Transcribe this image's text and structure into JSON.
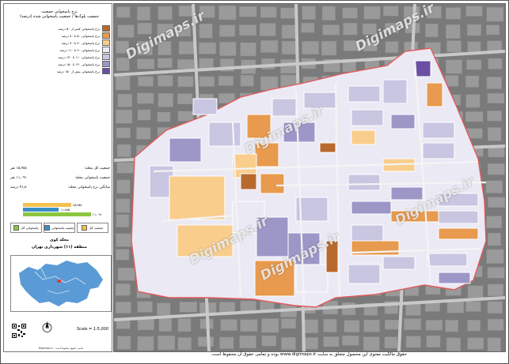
{
  "legend": {
    "title": "نرخ پاسخوانی جمعیت",
    "subtitle": "جمعیت بلوک‌ها / جمعیت پاسخوانی شده (درصد)",
    "items": [
      {
        "label": "نرخ پاسخوانی کمتر از ۵۰ درصد",
        "color": "#b8692e"
      },
      {
        "label": "نرخ پاسخوانی ۵۰ تا ۷۰ درصد",
        "color": "#e89a4e"
      },
      {
        "label": "نرخ پاسخوانی ۷۰ تا ۹۰ درصد",
        "color": "#f9cd8c"
      },
      {
        "label": "نرخ پاسخوانی ۹۰ تا ۱۱۰ درصد",
        "color": "#ebe9f4"
      },
      {
        "label": "نرخ پاسخوانی ۱۱۰ تا ۱۳۰ درصد",
        "color": "#c9c6e2"
      },
      {
        "label": "نرخ پاسخوانی ۱۳۰ تا ۱۵۰ درصد",
        "color": "#9d97c8"
      },
      {
        "label": "نرخ پاسخوانی بیش از ۱۵۰ درصد",
        "color": "#6a4fa2"
      }
    ]
  },
  "stats": [
    {
      "label": "جمعیت کل محله:",
      "value": "۱۵,۲۵۸ نفر"
    },
    {
      "label": "جمعیت پاسخوانی محله:",
      "value": "۱۱,۰۹۱ نفر"
    },
    {
      "label": "میانگین نرخ پاسخوانی محله:",
      "value": "۹۱٫۸ درصد"
    }
  ],
  "bars": [
    {
      "label": "۱۵,۲۵۸",
      "color": "#f2c14e",
      "fraction": 0.55
    },
    {
      "label": "۱۱,۸۷۵",
      "color": "#3a8fc7",
      "fraction": 0.41
    },
    {
      "label": "۱۱,۰۹۱",
      "color": "#8cc63f",
      "fraction": 0.78
    }
  ],
  "legend_boxes": [
    {
      "label": "جمعیت کل",
      "color": "#f2c14e"
    },
    {
      "label": "جمعیت پاسخوانی",
      "color": "#3a8fc7"
    },
    {
      "label": "پاسخوانی کل",
      "color": "#8cc63f"
    }
  ],
  "inset": {
    "title1": "محله کوی",
    "title2": "منطقه (۱۱) شهرداری تهران",
    "fill": "#5b9bd5",
    "highlight": "#d94040"
  },
  "north": "N",
  "scale": "Scale = 1:5,000",
  "credit": "Digimaps.ir · تمامی حقوق محفوظ است",
  "footer": "حقوق مالکیت معنوی این محصول متعلق به سایت www.digimaps.ir بوده و تمامی حقوق آن محفوظ است.",
  "watermark": "Digimaps.ir"
}
